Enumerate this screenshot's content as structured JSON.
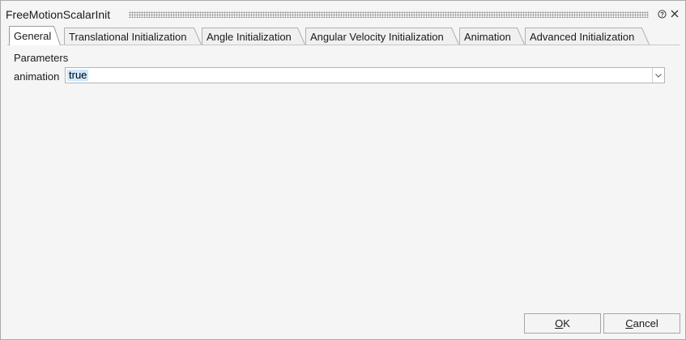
{
  "window": {
    "title": "FreeMotionScalarInit"
  },
  "titlebar": {
    "help_icon": "help-circle-icon",
    "close_icon": "close-icon"
  },
  "tabs": [
    {
      "label": "General",
      "active": true
    },
    {
      "label": "Translational Initialization",
      "active": false
    },
    {
      "label": "Angle Initialization",
      "active": false
    },
    {
      "label": "Angular Velocity Initialization",
      "active": false
    },
    {
      "label": "Animation",
      "active": false
    },
    {
      "label": "Advanced Initialization",
      "active": false
    }
  ],
  "general": {
    "section_label": "Parameters",
    "animation": {
      "label": "animation",
      "value": "true",
      "dropdown_icon": "chevron-down-icon"
    }
  },
  "buttons": {
    "ok": {
      "label": "OK",
      "mnemonic": "O",
      "rest": "K"
    },
    "cancel": {
      "label": "Cancel",
      "mnemonic": "C",
      "rest": "ancel"
    }
  },
  "colors": {
    "selection": "#cce8ff",
    "window_bg": "#f5f5f5",
    "border": "#a9a9a9"
  }
}
